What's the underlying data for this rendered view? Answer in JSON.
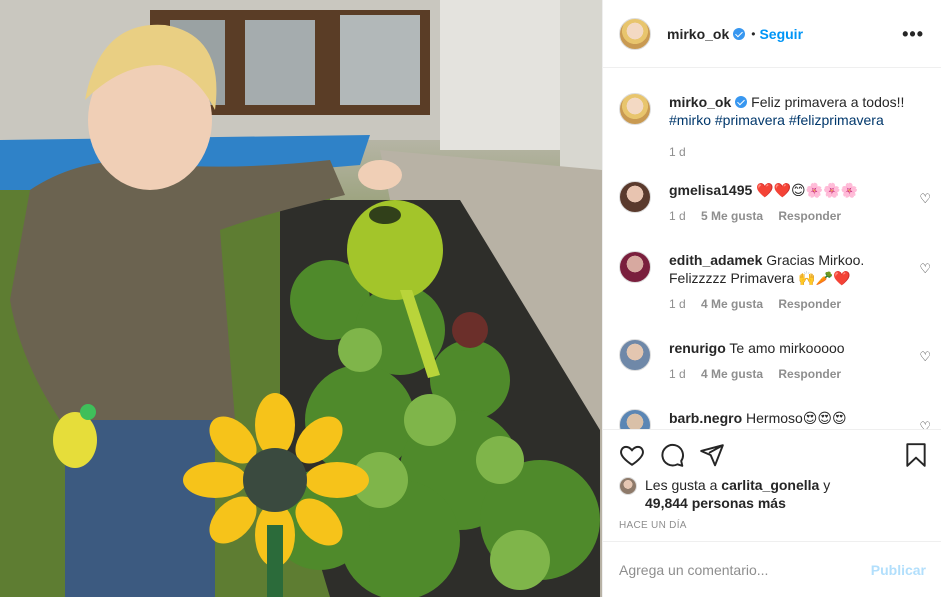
{
  "post": {
    "username": "mirko_ok",
    "separator": "•",
    "follow_label": "Seguir",
    "more_label": "•••",
    "caption": {
      "text": "Feliz primavera a todos!!",
      "hashtags": "#mirko #primavera #felizprimavera",
      "time": "1 d"
    }
  },
  "comments": [
    {
      "user": "gmelisa1495",
      "text": "❤️❤️😊🌸🌸🌸",
      "time": "1 d",
      "likes": "5 Me gusta",
      "reply": "Responder"
    },
    {
      "user": "edith_adamek",
      "text": "Gracias Mirkoo. Felizzzzz Primavera 🙌🥕❤️",
      "time": "1 d",
      "likes": "4 Me gusta",
      "reply": "Responder"
    },
    {
      "user": "renurigo",
      "text": "Te amo mirkooooo",
      "time": "1 d",
      "likes": "4 Me gusta",
      "reply": "Responder"
    },
    {
      "user": "barb.negro",
      "text": "Hermoso😍😍😍",
      "time": "",
      "likes": "",
      "reply": ""
    }
  ],
  "actions": {
    "liked_by_prefix": "Les gusta a",
    "liked_by_user": "carlita_gonella",
    "liked_by_suffix": "y",
    "others_count": "49,844 personas más",
    "posted_ago": "HACE UN DÍA"
  },
  "add_comment": {
    "placeholder": "Agrega un comentario...",
    "publish_label": "Publicar"
  },
  "colors": {
    "accent": "#0095f6",
    "verified": "#3897f0",
    "publish_disabled": "#b2dffc",
    "muted": "#8e8e8e"
  },
  "icons": [
    "verified-badge-icon",
    "more-options-icon",
    "heart-icon",
    "comment-icon",
    "share-icon",
    "bookmark-icon"
  ]
}
